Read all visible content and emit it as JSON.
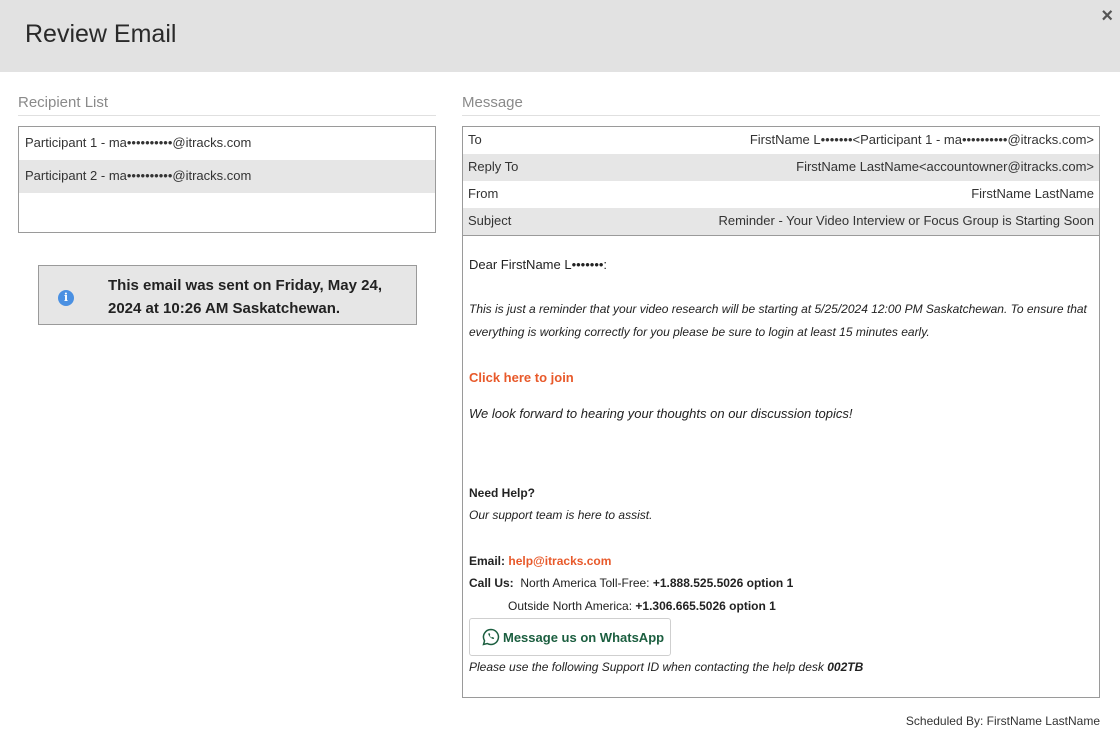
{
  "header": {
    "title": "Review Email",
    "close_label": "×"
  },
  "recipients": {
    "label": "Recipient List",
    "items": [
      "Participant 1 - ma••••••••••@itracks.com",
      "Participant 2 - ma••••••••••@itracks.com"
    ]
  },
  "info": {
    "icon": "info-icon",
    "text": "This email was sent on Friday, May 24, 2024 at 10:26 AM Saskatchewan."
  },
  "message": {
    "label": "Message",
    "meta": [
      {
        "key": "To",
        "value": "FirstName L•••••••<Participant 1 - ma••••••••••@itracks.com>"
      },
      {
        "key": "Reply To",
        "value": "FirstName LastName<accountowner@itracks.com>"
      },
      {
        "key": "From",
        "value": "FirstName LastName"
      },
      {
        "key": "Subject",
        "value": "Reminder - Your Video Interview or Focus Group is Starting Soon"
      }
    ],
    "body": {
      "greeting": "Dear FirstName L•••••••:",
      "para1_line1": "This is just a reminder that your video research will be starting at 5/25/2024 12:00 PM Saskatchewan. To ensure that",
      "para1_line2": "everything is working correctly for you please be sure to login at least 15 minutes early.",
      "join_link": "Click here to join",
      "para2": "We look forward to hearing your thoughts on our discussion topics!",
      "help_heading": "Need Help?",
      "help_sub": "Our support team is here to assist.",
      "email_label": "Email:",
      "email_value": "help@itracks.com",
      "call_label": "Call Us:",
      "na_label": "North America Toll-Free:",
      "na_number": "+1.888.525.5026 option 1",
      "outside_label": "Outside North America:",
      "outside_number": "+1.306.665.5026 option 1",
      "whatsapp_label": "Message us on WhatsApp",
      "support_text": "Please use the following Support ID when contacting the help desk",
      "support_id": "002TB"
    }
  },
  "footer": {
    "scheduled_by": "Scheduled By: FirstName LastName"
  },
  "colors": {
    "header_bg": "#e2e2e2",
    "link": "#e8592a",
    "info": "#4a90e2",
    "whatsapp": "#1b5e3f"
  }
}
